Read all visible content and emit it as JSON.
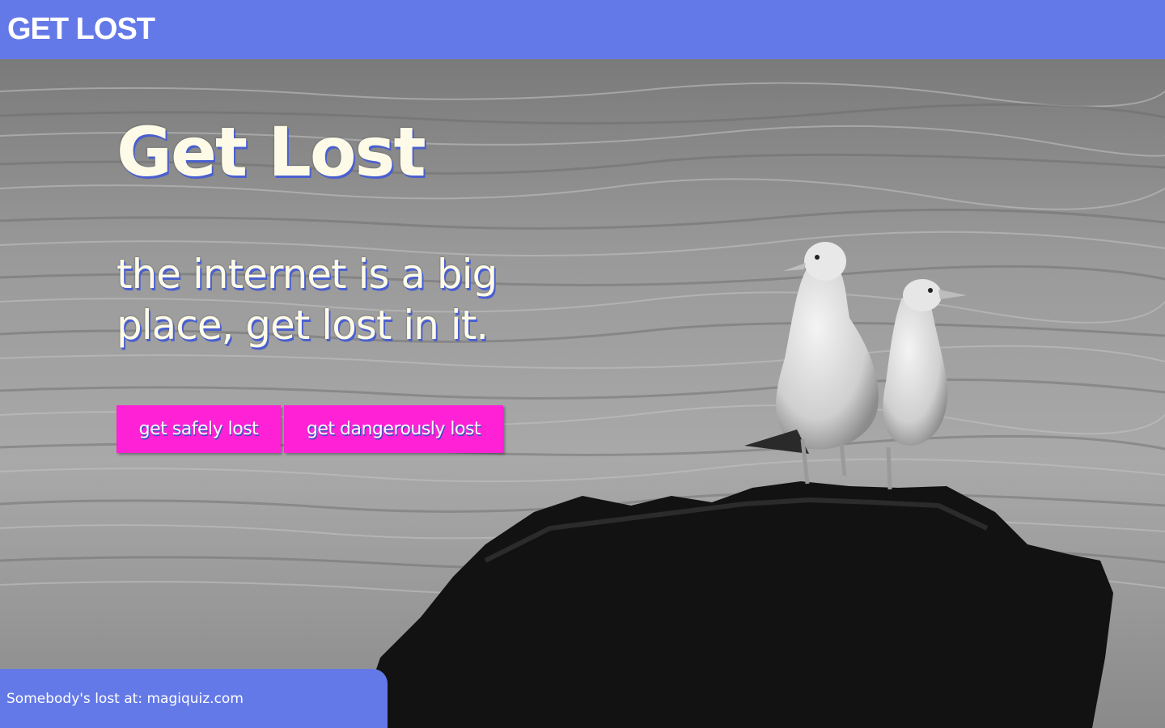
{
  "header": {
    "brand": "GET LOST"
  },
  "hero": {
    "title": "Get Lost",
    "subtitle": "the internet is a big place, get lost in it.",
    "buttons": {
      "safe_label": "get safely lost",
      "danger_label": "get dangerously lost"
    },
    "background_image": "black-and-white photo of two seagulls standing on a dark rock in front of the sea"
  },
  "footer": {
    "prefix": "Somebody's lost at:",
    "site": "magiquiz.com"
  },
  "colors": {
    "topbar": "#6479e8",
    "button": "#fe21d5",
    "title_text": "#fdfbe8",
    "text_shadow": "#4a5fcf"
  }
}
